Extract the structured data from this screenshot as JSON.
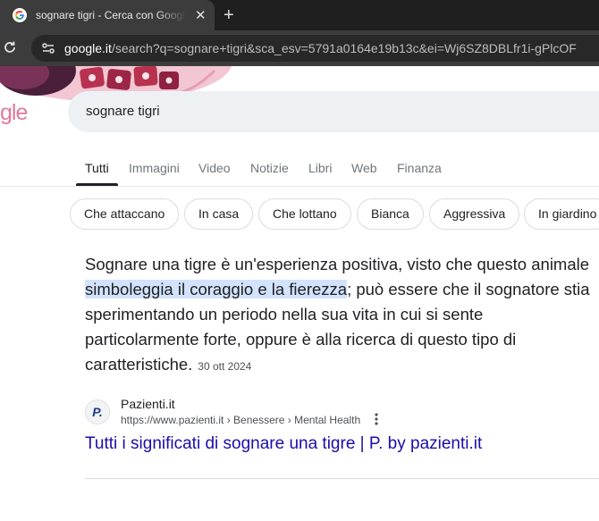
{
  "browser": {
    "tab_title": "sognare tigri - Cerca con Google",
    "close_glyph": "✕",
    "new_tab_glyph": "+",
    "url_host": "google.it",
    "url_path": "/search?q=sognare+tigri&sca_esv=5791a0164e19b13c&ei=Wj6SZ8DBLfr1i-gPlcOF"
  },
  "logo_fragment": "gle",
  "search": {
    "query": "sognare tigri"
  },
  "nav_tabs": [
    {
      "label": "Tutti",
      "active": true
    },
    {
      "label": "Immagini"
    },
    {
      "label": "Video"
    },
    {
      "label": "Notizie"
    },
    {
      "label": "Libri"
    },
    {
      "label": "Web"
    },
    {
      "label": "Finanza"
    }
  ],
  "chips": [
    {
      "label": "Che attaccano"
    },
    {
      "label": "In casa"
    },
    {
      "label": "Che lottano"
    },
    {
      "label": "Bianca"
    },
    {
      "label": "Aggressiva"
    },
    {
      "label": "In giardino"
    }
  ],
  "snippet": {
    "text_before": "Sognare una tigre è un'esperienza positiva, visto che questo animale ",
    "highlight": "simboleggia il coraggio e la fierezza",
    "text_after": "; può essere che il sognatore stia sperimentando un periodo nella sua vita in cui si sente particolarmente forte, oppure è alla ricerca di questo tipo di caratteristiche.",
    "date": "30 ott 2024"
  },
  "source": {
    "favicon_letter": "P.",
    "name": "Pazienti.it",
    "url": "https://www.pazienti.it › Benessere › Mental Health",
    "title": "Tutti i significati di sognare una tigre | P. by pazienti.it"
  },
  "colors": {
    "link": "#1a0dab",
    "highlight": "#d3e3fd",
    "chrome_dark": "#1f1f1f"
  }
}
